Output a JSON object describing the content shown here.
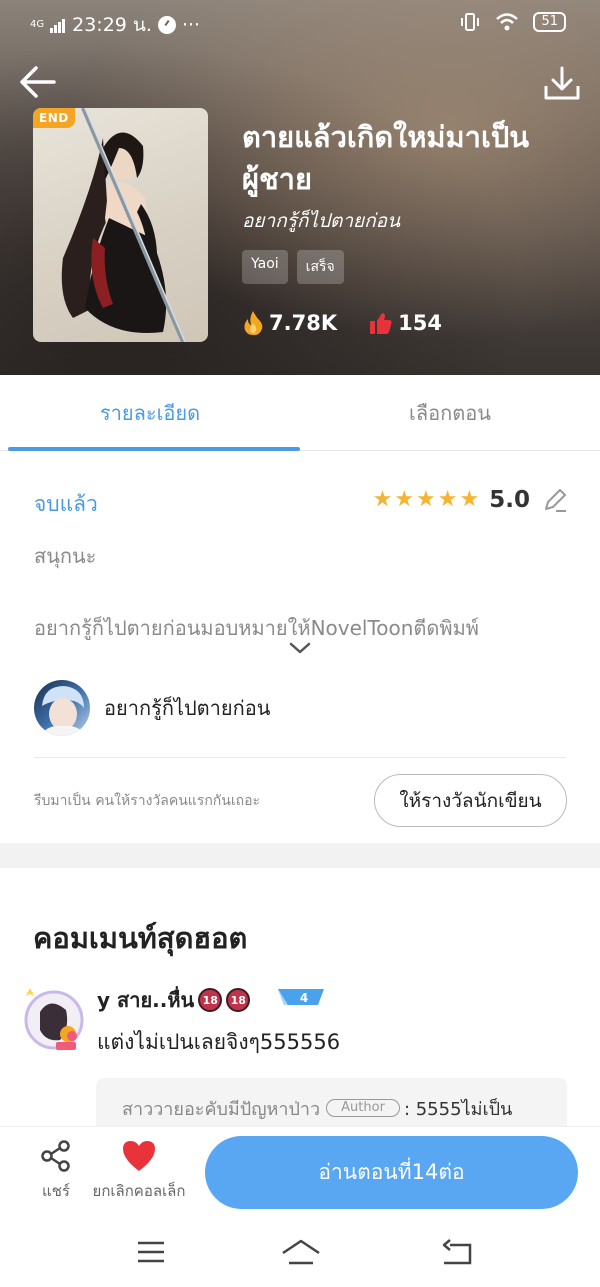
{
  "status_bar": {
    "network": "4G",
    "time": "23:29 น.",
    "more": "···",
    "battery": "51"
  },
  "book": {
    "badge": "END",
    "title": "ตายแล้วเกิดใหม่มาเป็นผู้ชาย",
    "author": "อยากรู้ก็ไปตายก่อน",
    "tags": [
      "Yaoi",
      "เสร็จ"
    ],
    "views": "7.78K",
    "likes": "154"
  },
  "tabs": [
    {
      "label": "รายละเอียด",
      "active": true
    },
    {
      "label": "เลือกตอน",
      "active": false
    }
  ],
  "details": {
    "status": "จบแล้ว",
    "rating_stars": 5,
    "rating": "5.0",
    "synopsis": "สนุกนะ",
    "announcement": "อยากรู้ก็ไปตายก่อนมอบหมายให้NovelToonตีดพิมพ์",
    "author_name": "อยากรู้ก็ไปตายก่อน",
    "reward_hint": "รีบมาเป็น คนให้รางวัลคนแรกกันเถอะ",
    "reward_button": "ให้รางวัลนักเขียน"
  },
  "comments": {
    "title": "คอมเมนท์สุดฮอต",
    "items": [
      {
        "user": "y สาย..หื่น",
        "badges": [
          "18",
          "18"
        ],
        "level": "4",
        "text": "แต่งไม่เปนเลยจิงๆ555556",
        "reply": {
          "user": "สาววายอะคับมีปัญหาป่าว",
          "tag": "Author",
          "text": ": 5555ไม่เป็น"
        }
      }
    ]
  },
  "actions": {
    "share": "แชร์",
    "unfavorite": "ยกเลิกคอลเล็ก",
    "read": "อ่านตอนที่14ต่อ"
  },
  "colors": {
    "accent": "#4a9be6",
    "button": "#59a7f2",
    "badge": "#f5a524",
    "star": "#f5b431",
    "heart": "#e8333b"
  }
}
